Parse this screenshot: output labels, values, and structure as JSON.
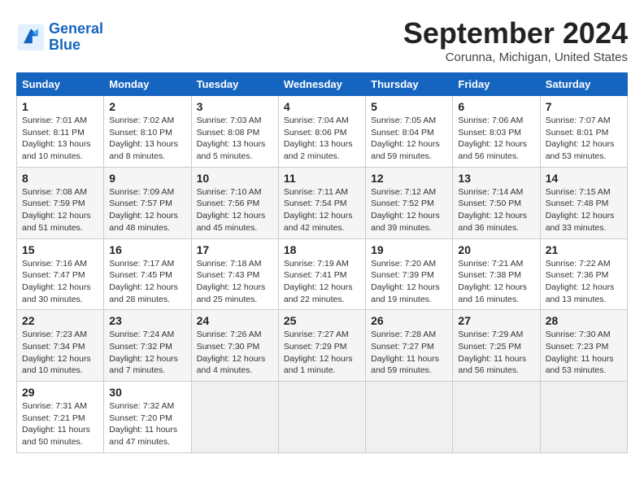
{
  "logo": {
    "line1": "General",
    "line2": "Blue"
  },
  "header": {
    "title": "September 2024",
    "location": "Corunna, Michigan, United States"
  },
  "weekdays": [
    "Sunday",
    "Monday",
    "Tuesday",
    "Wednesday",
    "Thursday",
    "Friday",
    "Saturday"
  ],
  "weeks": [
    [
      {
        "day": "1",
        "info": "Sunrise: 7:01 AM\nSunset: 8:11 PM\nDaylight: 13 hours\nand 10 minutes."
      },
      {
        "day": "2",
        "info": "Sunrise: 7:02 AM\nSunset: 8:10 PM\nDaylight: 13 hours\nand 8 minutes."
      },
      {
        "day": "3",
        "info": "Sunrise: 7:03 AM\nSunset: 8:08 PM\nDaylight: 13 hours\nand 5 minutes."
      },
      {
        "day": "4",
        "info": "Sunrise: 7:04 AM\nSunset: 8:06 PM\nDaylight: 13 hours\nand 2 minutes."
      },
      {
        "day": "5",
        "info": "Sunrise: 7:05 AM\nSunset: 8:04 PM\nDaylight: 12 hours\nand 59 minutes."
      },
      {
        "day": "6",
        "info": "Sunrise: 7:06 AM\nSunset: 8:03 PM\nDaylight: 12 hours\nand 56 minutes."
      },
      {
        "day": "7",
        "info": "Sunrise: 7:07 AM\nSunset: 8:01 PM\nDaylight: 12 hours\nand 53 minutes."
      }
    ],
    [
      {
        "day": "8",
        "info": "Sunrise: 7:08 AM\nSunset: 7:59 PM\nDaylight: 12 hours\nand 51 minutes."
      },
      {
        "day": "9",
        "info": "Sunrise: 7:09 AM\nSunset: 7:57 PM\nDaylight: 12 hours\nand 48 minutes."
      },
      {
        "day": "10",
        "info": "Sunrise: 7:10 AM\nSunset: 7:56 PM\nDaylight: 12 hours\nand 45 minutes."
      },
      {
        "day": "11",
        "info": "Sunrise: 7:11 AM\nSunset: 7:54 PM\nDaylight: 12 hours\nand 42 minutes."
      },
      {
        "day": "12",
        "info": "Sunrise: 7:12 AM\nSunset: 7:52 PM\nDaylight: 12 hours\nand 39 minutes."
      },
      {
        "day": "13",
        "info": "Sunrise: 7:14 AM\nSunset: 7:50 PM\nDaylight: 12 hours\nand 36 minutes."
      },
      {
        "day": "14",
        "info": "Sunrise: 7:15 AM\nSunset: 7:48 PM\nDaylight: 12 hours\nand 33 minutes."
      }
    ],
    [
      {
        "day": "15",
        "info": "Sunrise: 7:16 AM\nSunset: 7:47 PM\nDaylight: 12 hours\nand 30 minutes."
      },
      {
        "day": "16",
        "info": "Sunrise: 7:17 AM\nSunset: 7:45 PM\nDaylight: 12 hours\nand 28 minutes."
      },
      {
        "day": "17",
        "info": "Sunrise: 7:18 AM\nSunset: 7:43 PM\nDaylight: 12 hours\nand 25 minutes."
      },
      {
        "day": "18",
        "info": "Sunrise: 7:19 AM\nSunset: 7:41 PM\nDaylight: 12 hours\nand 22 minutes."
      },
      {
        "day": "19",
        "info": "Sunrise: 7:20 AM\nSunset: 7:39 PM\nDaylight: 12 hours\nand 19 minutes."
      },
      {
        "day": "20",
        "info": "Sunrise: 7:21 AM\nSunset: 7:38 PM\nDaylight: 12 hours\nand 16 minutes."
      },
      {
        "day": "21",
        "info": "Sunrise: 7:22 AM\nSunset: 7:36 PM\nDaylight: 12 hours\nand 13 minutes."
      }
    ],
    [
      {
        "day": "22",
        "info": "Sunrise: 7:23 AM\nSunset: 7:34 PM\nDaylight: 12 hours\nand 10 minutes."
      },
      {
        "day": "23",
        "info": "Sunrise: 7:24 AM\nSunset: 7:32 PM\nDaylight: 12 hours\nand 7 minutes."
      },
      {
        "day": "24",
        "info": "Sunrise: 7:26 AM\nSunset: 7:30 PM\nDaylight: 12 hours\nand 4 minutes."
      },
      {
        "day": "25",
        "info": "Sunrise: 7:27 AM\nSunset: 7:29 PM\nDaylight: 12 hours\nand 1 minute."
      },
      {
        "day": "26",
        "info": "Sunrise: 7:28 AM\nSunset: 7:27 PM\nDaylight: 11 hours\nand 59 minutes."
      },
      {
        "day": "27",
        "info": "Sunrise: 7:29 AM\nSunset: 7:25 PM\nDaylight: 11 hours\nand 56 minutes."
      },
      {
        "day": "28",
        "info": "Sunrise: 7:30 AM\nSunset: 7:23 PM\nDaylight: 11 hours\nand 53 minutes."
      }
    ],
    [
      {
        "day": "29",
        "info": "Sunrise: 7:31 AM\nSunset: 7:21 PM\nDaylight: 11 hours\nand 50 minutes."
      },
      {
        "day": "30",
        "info": "Sunrise: 7:32 AM\nSunset: 7:20 PM\nDaylight: 11 hours\nand 47 minutes."
      },
      null,
      null,
      null,
      null,
      null
    ]
  ]
}
